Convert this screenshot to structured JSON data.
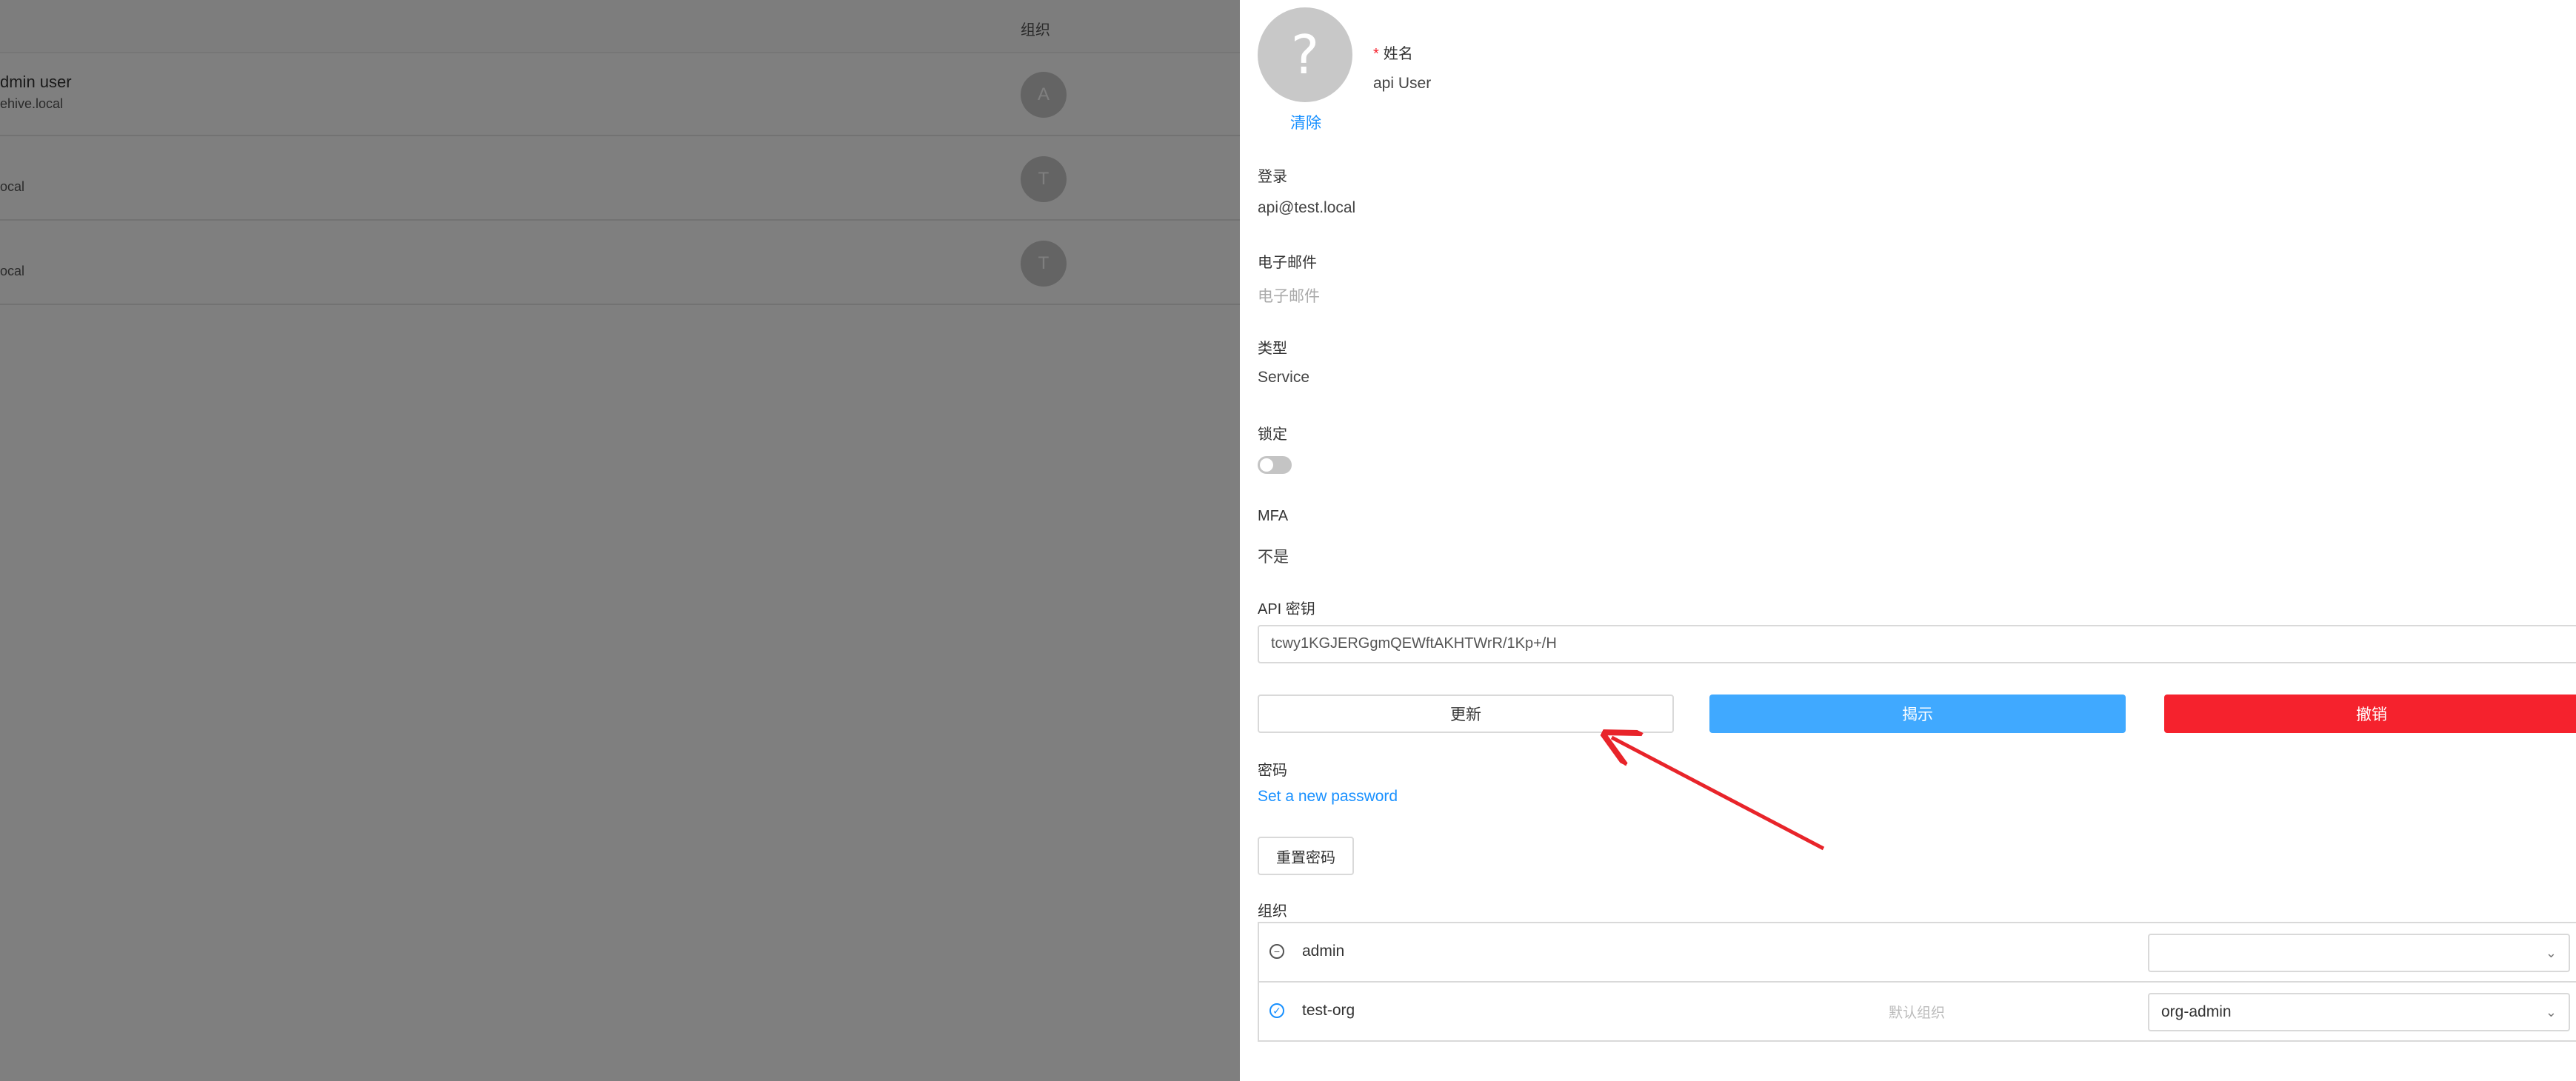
{
  "list": {
    "column_org": "组织",
    "rows": [
      {
        "name": "dmin user",
        "sub": "ehive.local",
        "avatar": "A"
      },
      {
        "name": "",
        "sub": "ocal",
        "avatar": "T"
      },
      {
        "name": "",
        "sub": "ocal",
        "avatar": "T"
      }
    ]
  },
  "drawer": {
    "avatar_glyph": "?",
    "clear_label": "清除",
    "name": {
      "required_mark": "*",
      "label": "姓名",
      "value": "api User"
    },
    "login": {
      "label": "登录",
      "value": "api@test.local"
    },
    "email": {
      "label": "电子邮件",
      "placeholder": "电子邮件"
    },
    "type": {
      "label": "类型",
      "value": "Service"
    },
    "locked": {
      "label": "锁定",
      "state": "off"
    },
    "mfa": {
      "label": "MFA",
      "value": "不是"
    },
    "api_key": {
      "label": "API 密钥",
      "value": "tcwy1KGJERGgmQEWftAKHTWrR/1Kp+/H",
      "renew_label": "更新",
      "reveal_label": "揭示",
      "revoke_label": "撤销"
    },
    "password": {
      "label": "密码",
      "set_link": "Set a new password",
      "reset_button": "重置密码"
    },
    "orgs": {
      "label": "组织",
      "items": [
        {
          "icon": "minus-circle-icon",
          "name": "admin",
          "default_label": "",
          "profile": ""
        },
        {
          "icon": "check-circle-icon",
          "name": "test-org",
          "default_label": "默认组织",
          "profile": "org-admin"
        }
      ]
    },
    "annotation_color": "#e8242a"
  }
}
